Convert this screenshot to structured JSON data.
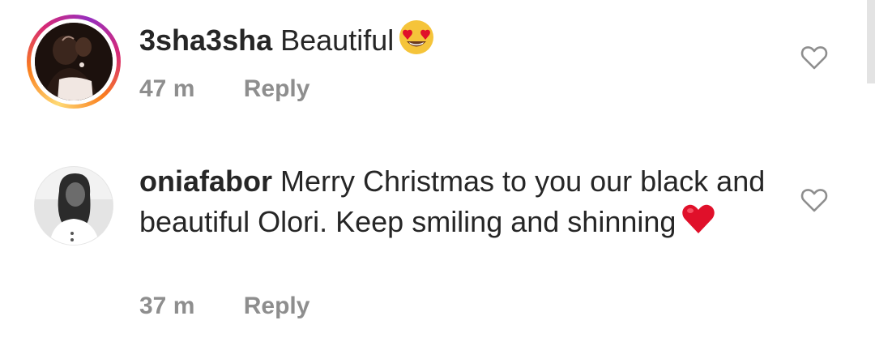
{
  "comments": [
    {
      "username": "3sha3sha",
      "text": "Beautiful",
      "emoji": "heart-eyes-emoji",
      "time": "47 m",
      "reply_label": "Reply",
      "has_story_ring": true
    },
    {
      "username": "oniafabor",
      "text": "Merry Christmas to you our black and  beautiful Olori. Keep smiling and shinning",
      "emoji": "red-heart-emoji",
      "time": "37 m",
      "reply_label": "Reply",
      "has_story_ring": false
    }
  ],
  "colors": {
    "text": "#262626",
    "meta": "#8e8e8e",
    "heart_emoji": "#e0102a",
    "emoji_face": "#f5c43a"
  }
}
